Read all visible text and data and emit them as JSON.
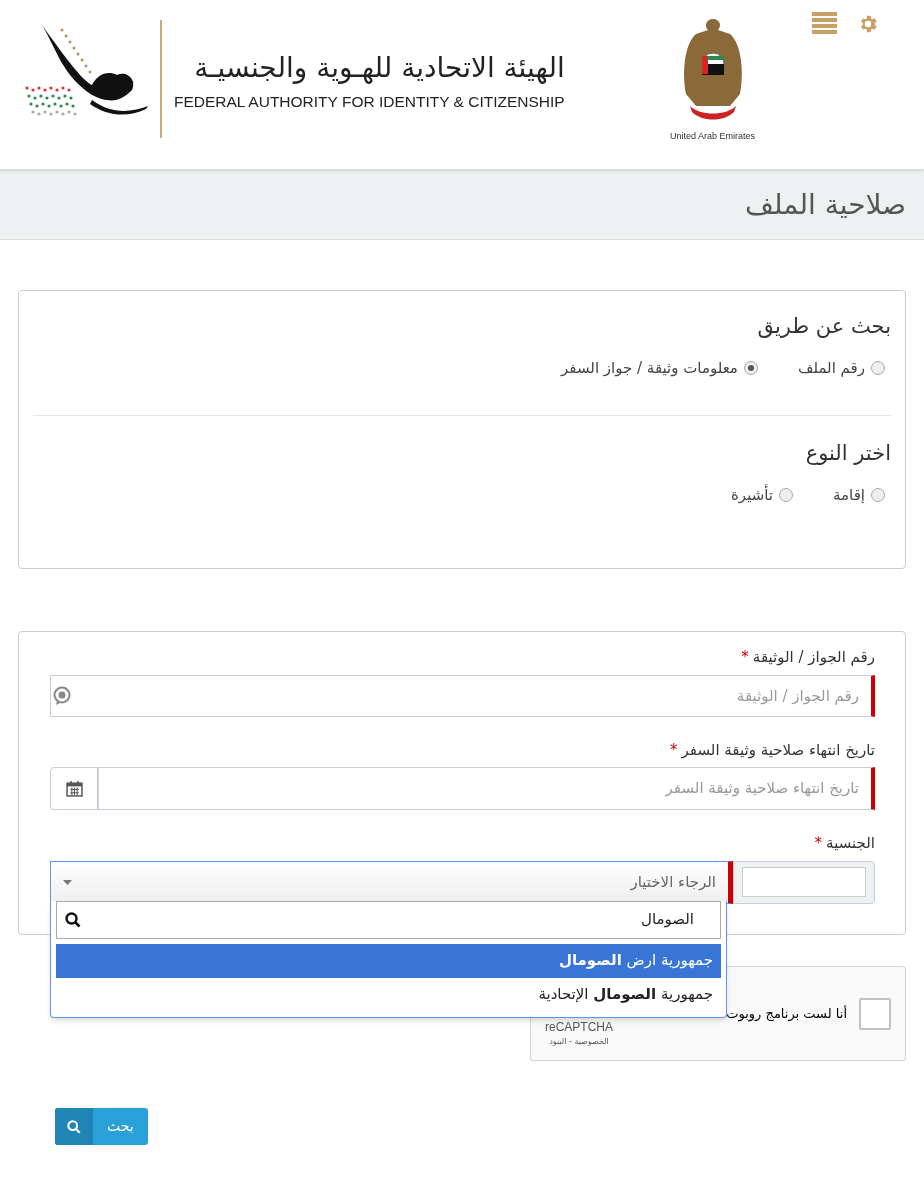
{
  "header": {
    "authority_name_ar": "الهيئة الاتحادية للهـوية والجنسيـة",
    "authority_name_en": "FEDERAL AUTHORITY FOR IDENTITY & CITIZENSHIP",
    "emblem_caption": "United Arab Emirates"
  },
  "page_title": "صلاحية الملف",
  "search_by": {
    "title": "بحث عن طريق",
    "options": [
      {
        "label": "رقم الملف",
        "selected": false
      },
      {
        "label": "معلومات وثيقة / جواز السفر",
        "selected": true
      }
    ]
  },
  "document_type": {
    "title": "اختر النوع",
    "options": [
      {
        "label": "إقامة",
        "selected": false
      },
      {
        "label": "تأشيرة",
        "selected": false
      }
    ]
  },
  "fields": [
    {
      "kind": "text",
      "label": "رقم الجواز / الوثيقة",
      "required": "*",
      "placeholder": "رقم الجواز / الوثيقة"
    },
    {
      "kind": "date",
      "label": "تاريخ انتهاء صلاحية وثيقة السفر",
      "required": "*",
      "placeholder": "تاريخ انتهاء صلاحية وثيقة السفر"
    }
  ],
  "nationality": {
    "label": "الجنسية",
    "required": "*",
    "placeholder": "الرجاء الاختيار",
    "expanded": true,
    "search_value": "الصومال",
    "options": [
      {
        "label": "جمهورية ارض **الصومال**",
        "selected": true
      },
      {
        "label": "جمهورية **الصومال** الإتحادية",
        "selected": false
      }
    ]
  },
  "captcha": {
    "label": "أنا لست برنامج روبوت",
    "checked": false,
    "brand": "reCAPTCHA",
    "links": "الخصوصية - البنود"
  },
  "search_button": "بحث"
}
